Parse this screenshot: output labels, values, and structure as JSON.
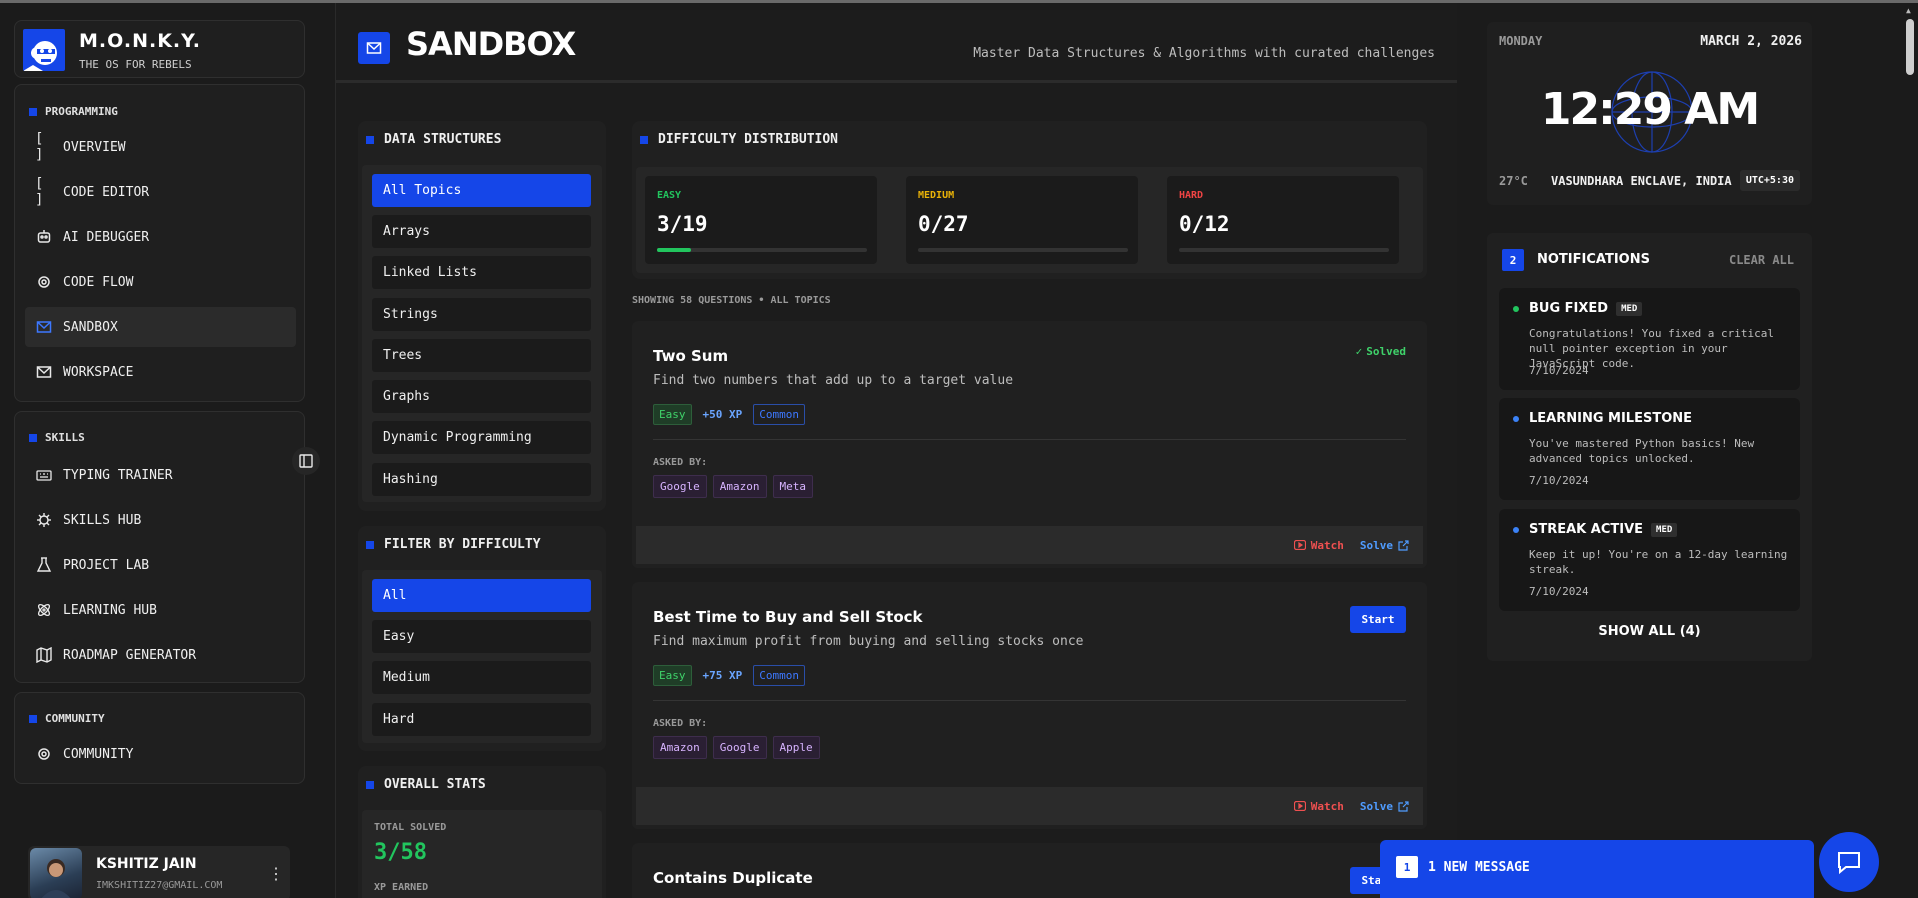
{
  "brand": {
    "name": "M.O.N.K.Y.",
    "tagline": "THE OS FOR REBELS"
  },
  "sidebar": {
    "groups": [
      {
        "title": "PROGRAMMING",
        "items": [
          {
            "label": "OVERVIEW",
            "icon": "brackets-icon"
          },
          {
            "label": "CODE EDITOR",
            "icon": "brackets-icon"
          },
          {
            "label": "AI DEBUGGER",
            "icon": "robot-icon"
          },
          {
            "label": "CODE FLOW",
            "icon": "chip-icon"
          },
          {
            "label": "SANDBOX",
            "icon": "mail-icon",
            "active": true
          },
          {
            "label": "WORKSPACE",
            "icon": "mail-icon"
          }
        ]
      },
      {
        "title": "SKILLS",
        "items": [
          {
            "label": "TYPING TRAINER",
            "icon": "keyboard-icon"
          },
          {
            "label": "SKILLS HUB",
            "icon": "bug-icon"
          },
          {
            "label": "PROJECT LAB",
            "icon": "flask-icon"
          },
          {
            "label": "LEARNING HUB",
            "icon": "atom-icon"
          },
          {
            "label": "ROADMAP GENERATOR",
            "icon": "map-icon"
          }
        ]
      },
      {
        "title": "COMMUNITY",
        "items": [
          {
            "label": "COMMUNITY",
            "icon": "chip-icon"
          }
        ]
      }
    ]
  },
  "user": {
    "name": "KSHITIZ JAIN",
    "email": "IMKSHITIZ27@GMAIL.COM"
  },
  "header": {
    "title": "SANDBOX",
    "subtitle": "Master Data Structures & Algorithms with curated challenges"
  },
  "data_structures": {
    "title": "DATA STRUCTURES",
    "items": [
      "All Topics",
      "Arrays",
      "Linked Lists",
      "Strings",
      "Trees",
      "Graphs",
      "Dynamic Programming",
      "Hashing"
    ]
  },
  "filter_difficulty": {
    "title": "FILTER BY DIFFICULTY",
    "items": [
      "All",
      "Easy",
      "Medium",
      "Hard"
    ]
  },
  "overall_stats": {
    "title": "OVERALL STATS",
    "total_solved_label": "TOTAL SOLVED",
    "total_solved_value": "3/58",
    "xp_label": "XP EARNED"
  },
  "distribution": {
    "title": "DIFFICULTY DISTRIBUTION",
    "cards": [
      {
        "label": "EASY",
        "value": "3/19",
        "progress": 0.16,
        "color": "#22c55e"
      },
      {
        "label": "MEDIUM",
        "value": "0/27",
        "progress": 0,
        "color": "#eab308"
      },
      {
        "label": "HARD",
        "value": "0/12",
        "progress": 0,
        "color": "#ef4444"
      }
    ]
  },
  "showing": "SHOWING 58 QUESTIONS • ALL TOPICS",
  "questions": [
    {
      "title": "Two Sum",
      "desc": "Find two numbers that add up to a target value",
      "difficulty": "Easy",
      "xp": "+50 XP",
      "freq": "Common",
      "asked_label": "ASKED BY:",
      "companies": [
        "Google",
        "Amazon",
        "Meta"
      ],
      "status": "Solved",
      "watch": "Watch",
      "solve": "Solve"
    },
    {
      "title": "Best Time to Buy and Sell Stock",
      "desc": "Find maximum profit from buying and selling stocks once",
      "difficulty": "Easy",
      "xp": "+75 XP",
      "freq": "Common",
      "asked_label": "ASKED BY:",
      "companies": [
        "Amazon",
        "Google",
        "Apple"
      ],
      "status": "Start",
      "watch": "Watch",
      "solve": "Solve"
    },
    {
      "title": "Contains Duplicate",
      "status": "Start"
    }
  ],
  "clock": {
    "day": "MONDAY",
    "date": "MARCH 2, 2026",
    "time": "12:29 AM",
    "temp": "27°C",
    "location": "VASUNDHARA ENCLAVE, INDIA",
    "utc": "UTC+5:30"
  },
  "notifications": {
    "count": "2",
    "title": "NOTIFICATIONS",
    "clear_label": "CLEAR ALL",
    "items": [
      {
        "title": "BUG FIXED",
        "badge": "MED",
        "body": "Congratulations! You fixed a critical null pointer exception in your JavaScript code.",
        "date": "7/10/2024",
        "dot": "#22c55e"
      },
      {
        "title": "LEARNING MILESTONE",
        "badge": "",
        "body": "You've mastered Python basics! New advanced topics unlocked.",
        "date": "7/10/2024",
        "dot": "#3b82f6"
      },
      {
        "title": "STREAK ACTIVE",
        "badge": "MED",
        "body": "Keep it up! You're on a 12-day learning streak.",
        "date": "7/10/2024",
        "dot": "#3b82f6"
      }
    ],
    "show_all": "SHOW ALL (4)"
  },
  "message_bar": {
    "count": "1",
    "label": "1 NEW MESSAGE"
  }
}
